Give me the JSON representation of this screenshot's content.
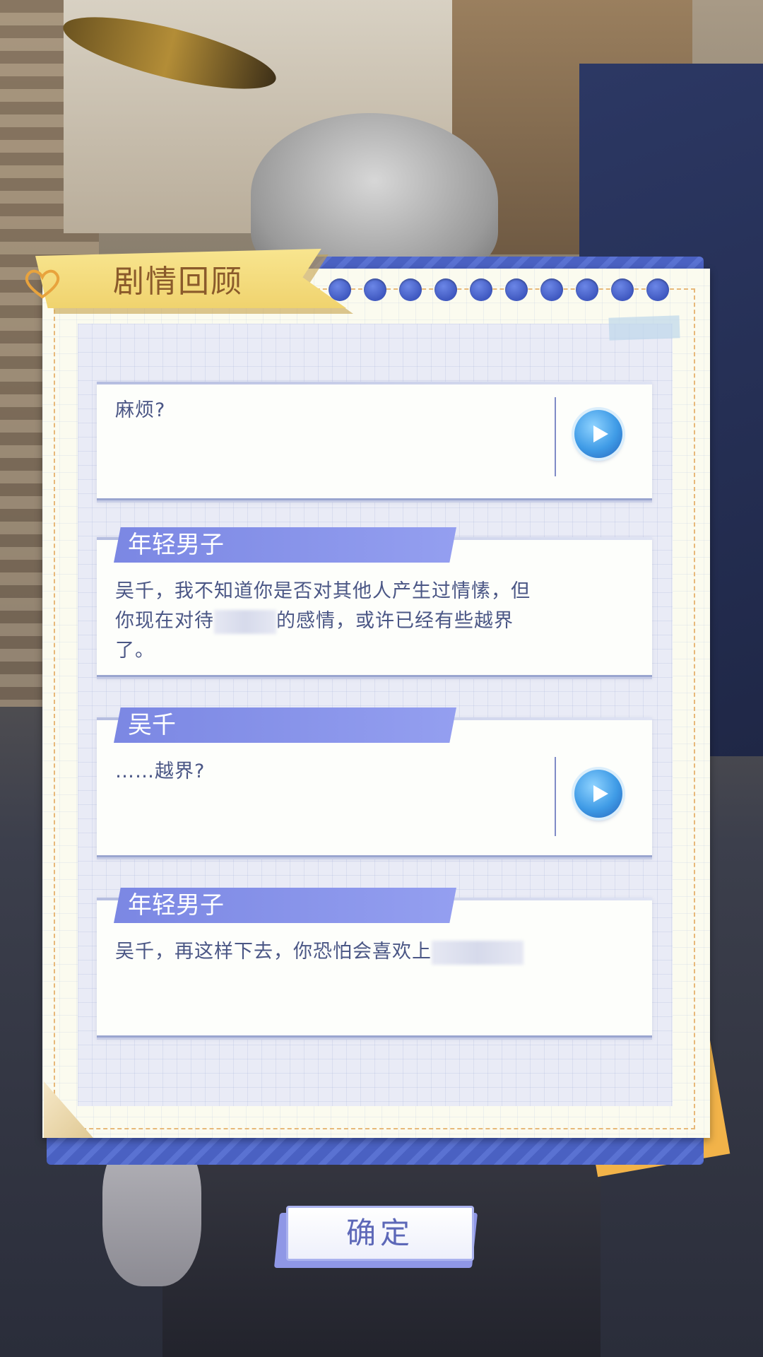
{
  "panel": {
    "title": "剧情回顾"
  },
  "dialogues": [
    {
      "speaker": "",
      "text": "麻烦?",
      "has_voice": true
    },
    {
      "speaker": "年轻男子",
      "text_before": "吴千，我不知道你是否对其他人产生过情愫，但你现在对待",
      "text_after": "的感情，或许已经有些越界了。",
      "has_voice": false
    },
    {
      "speaker": "吴千",
      "text": "……越界?",
      "has_voice": true
    },
    {
      "speaker": "年轻男子",
      "text": "吴千，再这样下去，你恐怕会喜欢上",
      "has_voice": false
    }
  ],
  "confirm_label": "确定",
  "colors": {
    "ribbon": "#f4dd80",
    "name_tag": "#8a95eb",
    "panel_frame": "#4a61c2",
    "play_button": "#3f9be6"
  },
  "icons": {
    "play": "play-icon",
    "title_decoration": "heart-clip-icon"
  }
}
